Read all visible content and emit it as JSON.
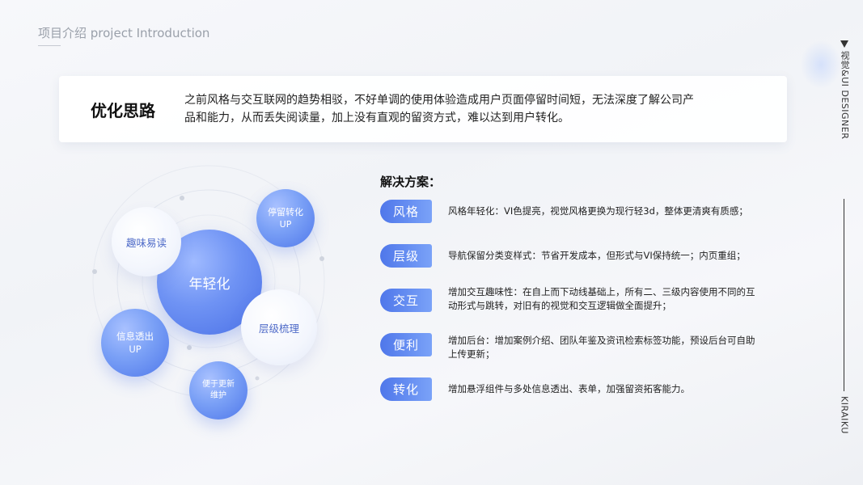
{
  "section_label": "项目介绍 project Introduction",
  "side": {
    "top_text": "视觉&UI DESIGNER",
    "bottom_text": "KIRAIKU"
  },
  "intro": {
    "title": "优化思路",
    "text": "之前风格与交互联网的趋势相驳，不好单调的使用体验造成用户页面停留时间短，无法深度了解公司产品和能力，从而丢失阅读量，加上没有直观的留资方式，难以达到用户转化。"
  },
  "bubbles": {
    "main": "年轻化",
    "fun": "趣味易读",
    "stay_line1": "停留转化",
    "stay_line2": "UP",
    "hier": "层级梳理",
    "info_line1": "信息透出",
    "info_line2": "UP",
    "maint_line1": "便于更新",
    "maint_line2": "维护"
  },
  "solutions": {
    "title": "解决方案：",
    "items": [
      {
        "tag": "风格",
        "text": "风格年轻化：VI色提亮，视觉风格更换为现行轻3d，整体更清爽有质感；"
      },
      {
        "tag": "层级",
        "text": "导航保留分类变样式：节省开发成本，但形式与VI保持统一；内页重组；"
      },
      {
        "tag": "交互",
        "text": "增加交互趣味性：在自上而下动线基础上，所有二、三级内容使用不同的互动形式与跳转，对旧有的视觉和交互逻辑做全面提升；"
      },
      {
        "tag": "便利",
        "text": "增加后台：增加案例介绍、团队年鉴及资讯检索标签功能，预设后台可自助上传更新；"
      },
      {
        "tag": "转化",
        "text": "增加悬浮组件与多处信息透出、表单，加强留资拓客能力。"
      }
    ]
  },
  "colors": {
    "accent": "#4f77ea",
    "accent_light": "#7aa2f8",
    "text_dark": "#222222",
    "label_gray": "#9aa0aa"
  }
}
